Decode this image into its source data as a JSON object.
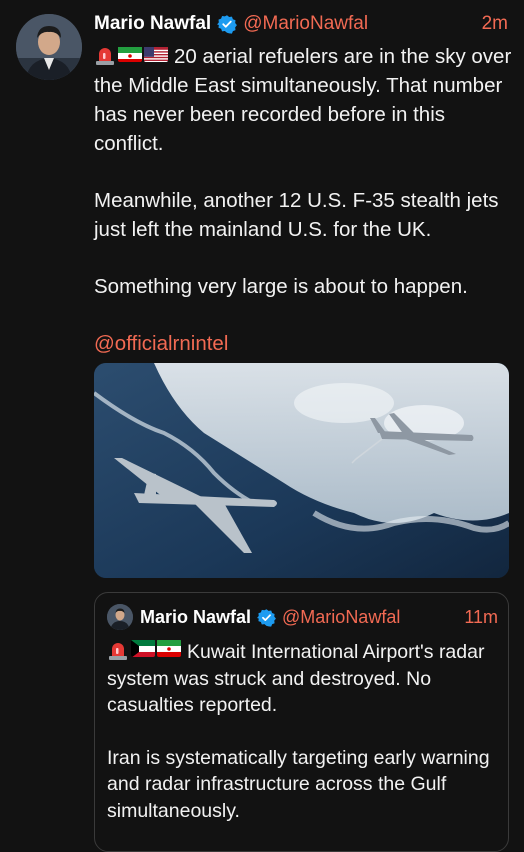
{
  "tweet": {
    "author_name": "Mario Nawfal",
    "handle": "@MarioNawfal",
    "time": "2m",
    "emojis": [
      "siren",
      "iran-flag",
      "us-flag"
    ],
    "paragraphs": [
      "20 aerial refuelers are in the sky over the Middle East simultaneously. That number has never been recorded before in this conflict.",
      "Meanwhile, another 12 U.S. F-35 stealth jets just left the mainland U.S. for the UK.",
      "Something very large is about to happen."
    ],
    "mention": "@officialrnintel"
  },
  "quote": {
    "author_name": "Mario Nawfal",
    "handle": "@MarioNawfal",
    "time": "11m",
    "emojis": [
      "siren",
      "kuwait-flag",
      "iran-flag"
    ],
    "paragraphs": [
      "Kuwait International Airport's radar system was struck and destroyed. No casualties reported.",
      "Iran is systematically targeting early warning and radar infrastructure across the Gulf simultaneously."
    ]
  },
  "colors": {
    "accent": "#f26a53",
    "verified": "#1d9bf0",
    "background": "#121212"
  }
}
